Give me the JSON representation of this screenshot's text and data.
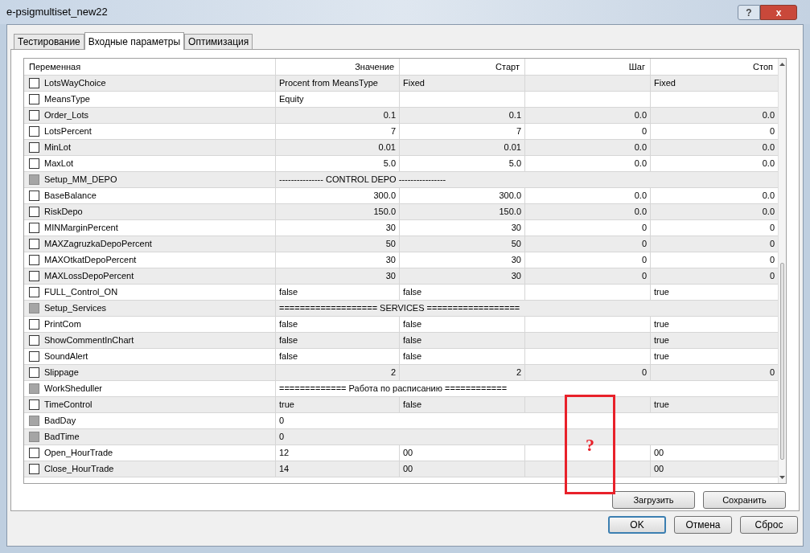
{
  "window": {
    "title": "e-psigmultiset_new22",
    "help": "?",
    "close": "x"
  },
  "tabs": [
    {
      "label": "Тестирование",
      "selected": false
    },
    {
      "label": "Входные параметры",
      "selected": true
    },
    {
      "label": "Оптимизация",
      "selected": false
    }
  ],
  "table": {
    "columns": [
      "Переменная",
      "Значение",
      "Старт",
      "Шаг",
      "Стоп"
    ],
    "rows": [
      {
        "kind": "text",
        "checked": false,
        "disabled": false,
        "cells": [
          "LotsWayChoice",
          "Procent from MeansType",
          "Fixed",
          "",
          "Fixed"
        ]
      },
      {
        "kind": "text",
        "checked": false,
        "disabled": false,
        "cells": [
          "MeansType",
          "Equity",
          "",
          "",
          ""
        ]
      },
      {
        "kind": "number",
        "checked": false,
        "disabled": false,
        "cells": [
          "Order_Lots",
          "0.1",
          "0.1",
          "0.0",
          "0.0"
        ]
      },
      {
        "kind": "number",
        "checked": false,
        "disabled": false,
        "cells": [
          "LotsPercent",
          "7",
          "7",
          "0",
          "0"
        ]
      },
      {
        "kind": "number",
        "checked": false,
        "disabled": false,
        "cells": [
          "MinLot",
          "0.01",
          "0.01",
          "0.0",
          "0.0"
        ]
      },
      {
        "kind": "number",
        "checked": false,
        "disabled": false,
        "cells": [
          "MaxLot",
          "5.0",
          "5.0",
          "0.0",
          "0.0"
        ]
      },
      {
        "kind": "wide",
        "checked": false,
        "disabled": true,
        "cells": [
          "Setup_MM_DEPO",
          "--------------- CONTROL DEPO ----------------"
        ]
      },
      {
        "kind": "number",
        "checked": false,
        "disabled": false,
        "cells": [
          "BaseBalance",
          "300.0",
          "300.0",
          "0.0",
          "0.0"
        ]
      },
      {
        "kind": "number",
        "checked": false,
        "disabled": false,
        "cells": [
          "RiskDepo",
          "150.0",
          "150.0",
          "0.0",
          "0.0"
        ]
      },
      {
        "kind": "number",
        "checked": false,
        "disabled": false,
        "cells": [
          "MINMarginPercent",
          "30",
          "30",
          "0",
          "0"
        ]
      },
      {
        "kind": "number",
        "checked": false,
        "disabled": false,
        "cells": [
          "MAXZagruzkaDepoPercent",
          "50",
          "50",
          "0",
          "0"
        ]
      },
      {
        "kind": "number",
        "checked": false,
        "disabled": false,
        "cells": [
          "MAXOtkatDepoPercent",
          "30",
          "30",
          "0",
          "0"
        ]
      },
      {
        "kind": "number",
        "checked": false,
        "disabled": false,
        "cells": [
          "MAXLossDepoPercent",
          "30",
          "30",
          "0",
          "0"
        ]
      },
      {
        "kind": "text",
        "checked": false,
        "disabled": false,
        "cells": [
          "FULL_Control_ON",
          "false",
          "false",
          "",
          "true"
        ]
      },
      {
        "kind": "wide",
        "checked": false,
        "disabled": true,
        "cells": [
          "Setup_Services",
          "=================== SERVICES =================="
        ]
      },
      {
        "kind": "text",
        "checked": false,
        "disabled": false,
        "cells": [
          "PrintCom",
          "false",
          "false",
          "",
          "true"
        ]
      },
      {
        "kind": "text",
        "checked": false,
        "disabled": false,
        "cells": [
          "ShowCommentInChart",
          "false",
          "false",
          "",
          "true"
        ]
      },
      {
        "kind": "text",
        "checked": false,
        "disabled": false,
        "cells": [
          "SoundAlert",
          "false",
          "false",
          "",
          "true"
        ]
      },
      {
        "kind": "number",
        "checked": false,
        "disabled": false,
        "cells": [
          "Slippage",
          "2",
          "2",
          "0",
          "0"
        ]
      },
      {
        "kind": "wide",
        "checked": false,
        "disabled": true,
        "cells": [
          "WorkSheduller",
          "============= Работа по расписанию ============"
        ]
      },
      {
        "kind": "text",
        "checked": false,
        "disabled": false,
        "cells": [
          "TimeControl",
          "true",
          "false",
          "",
          "true"
        ]
      },
      {
        "kind": "wide",
        "checked": false,
        "disabled": true,
        "cells": [
          "BadDay",
          "0"
        ]
      },
      {
        "kind": "wide",
        "checked": false,
        "disabled": true,
        "cells": [
          "BadTime",
          "0"
        ]
      },
      {
        "kind": "text",
        "checked": false,
        "disabled": false,
        "cells": [
          "Open_HourTrade",
          "12",
          "00",
          "",
          "00"
        ]
      },
      {
        "kind": "text",
        "checked": false,
        "disabled": false,
        "cells": [
          "Close_HourTrade",
          "14",
          "00",
          "",
          "00"
        ]
      }
    ]
  },
  "panel_buttons": [
    "Загрузить",
    "Сохранить"
  ],
  "dialog_buttons": [
    {
      "label": "OK",
      "default": true
    },
    {
      "label": "Отмена",
      "default": false
    },
    {
      "label": "Сброс",
      "default": false
    }
  ],
  "annotation": {
    "text": "?"
  }
}
